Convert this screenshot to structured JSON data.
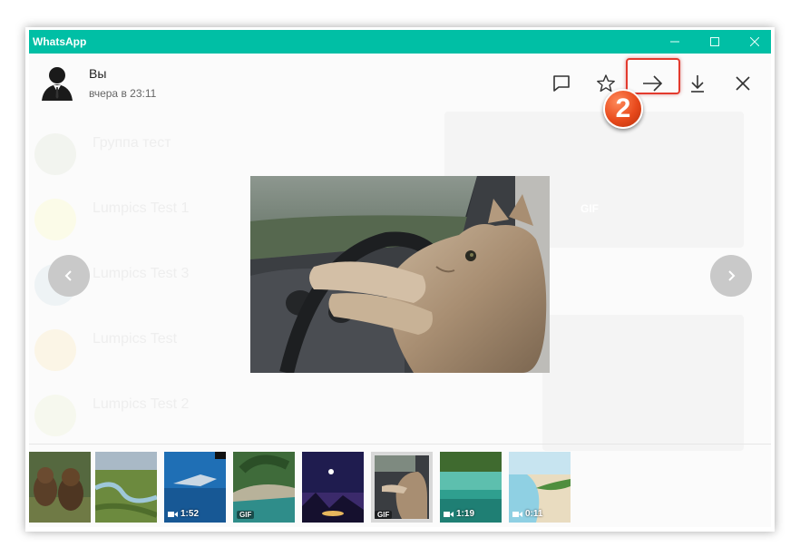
{
  "window": {
    "title": "WhatsApp"
  },
  "header": {
    "sender": "Вы",
    "time": "вчера в 23:11"
  },
  "annotation": {
    "step": "2"
  },
  "background_chats": [
    {
      "name": "",
      "message": ""
    },
    {
      "name": "Группа тест",
      "message": ""
    },
    {
      "name": "Lumpics Test 1",
      "message": ""
    },
    {
      "name": "Lumpics Test 3",
      "message": ""
    },
    {
      "name": "Lumpics Test",
      "message": ""
    },
    {
      "name": "Lumpics Test 2",
      "message": ""
    }
  ],
  "background_panels": {
    "gif_label": "GIF"
  },
  "thumbnails": [
    {
      "kind": "image",
      "label": ""
    },
    {
      "kind": "image",
      "label": ""
    },
    {
      "kind": "video",
      "label": "1:52"
    },
    {
      "kind": "gif",
      "label": "GIF"
    },
    {
      "kind": "image",
      "label": ""
    },
    {
      "kind": "gif",
      "label": "GIF"
    },
    {
      "kind": "video",
      "label": "1:19"
    },
    {
      "kind": "video",
      "label": "0:11"
    }
  ],
  "colors": {
    "titlebar": "#00bfa5",
    "highlight": "#e33a2e",
    "badge": "#e84a1c"
  }
}
